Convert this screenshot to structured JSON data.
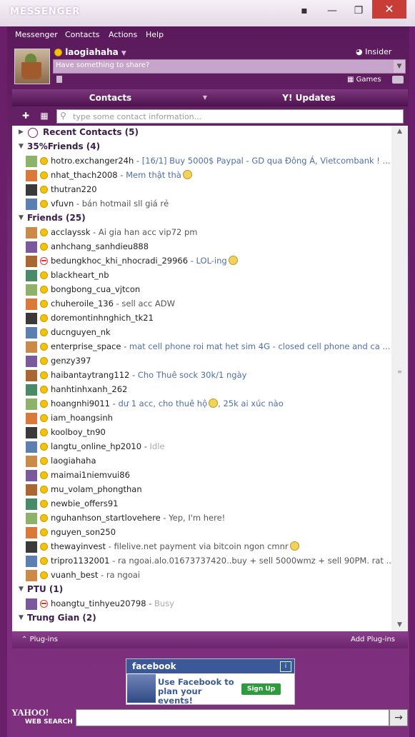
{
  "window": {
    "title": "MESSENGER",
    "min_label": "—",
    "max_label": "❐",
    "close_label": "✕"
  },
  "menu": {
    "items": [
      "Messenger",
      "Contacts",
      "Actions",
      "Help"
    ]
  },
  "profile": {
    "username": "laogiahaha",
    "insider_label": "Insider",
    "share_placeholder": "Have something to share?",
    "games_label": "Games"
  },
  "tabs": {
    "contacts": "Contacts",
    "updates": "Y! Updates"
  },
  "search": {
    "placeholder": "type some contact information..."
  },
  "contacts": {
    "recent": {
      "label": "Recent Contacts (5)"
    },
    "groups": [
      {
        "label": "35%Friends (4)",
        "rows": [
          {
            "name": "hotro.exchanger24h",
            "msg": "[16/1] Buy 5000$ Paypal - GD qua Đông Á, Vietcombank ! ...",
            "status": "available",
            "style": "blue"
          },
          {
            "name": "nhat_thach2008",
            "msg": "Mem thật thà",
            "status": "available",
            "style": "blue",
            "emoji": true
          },
          {
            "name": "thutran220",
            "msg": "",
            "status": "available"
          },
          {
            "name": "vfuvn",
            "msg": "bán hotmail sll giá rẻ",
            "status": "available",
            "style": "gray"
          }
        ]
      },
      {
        "label": "Friends (25)",
        "rows": [
          {
            "name": "acclayssk",
            "msg": "Ai gia han acc vip72 pm",
            "status": "available",
            "style": "gray"
          },
          {
            "name": "anhchang_sanhdieu888",
            "msg": "",
            "status": "available"
          },
          {
            "name": "bedungkhoc_khi_nhocradi_29966",
            "msg": "LOL-ing",
            "status": "busy",
            "style": "blue",
            "emoji": true
          },
          {
            "name": "blackheart_nb",
            "msg": "",
            "status": "available"
          },
          {
            "name": "bongbong_cua_vjtcon",
            "msg": "",
            "status": "available"
          },
          {
            "name": "chuheroile_136",
            "msg": "sell acc ADW",
            "status": "available",
            "style": "gray"
          },
          {
            "name": "doremontinhnghich_tk21",
            "msg": "",
            "status": "available"
          },
          {
            "name": "ducnguyen_nk",
            "msg": "",
            "status": "available"
          },
          {
            "name": "enterprise_space",
            "msg": "mat cell phone roi mat het sim 4G - closed cell phone and ca ...",
            "status": "available",
            "style": "blue"
          },
          {
            "name": "genzy397",
            "msg": "",
            "status": "available"
          },
          {
            "name": "haibantaytrang112",
            "msg": "Cho Thuê sock 30k/1 ngày",
            "status": "available",
            "style": "blue"
          },
          {
            "name": "hanhtinhxanh_262",
            "msg": "",
            "status": "available"
          },
          {
            "name": "hoangnhi9011",
            "msg": "dư 1 acc, cho thuê hộ",
            "msg2": ", 25k ai xúc nào",
            "status": "available",
            "style": "blue",
            "emoji": true
          },
          {
            "name": "iam_hoangsinh",
            "msg": "",
            "status": "available"
          },
          {
            "name": "koolboy_tn90",
            "msg": "",
            "status": "available"
          },
          {
            "name": "langtu_online_hp2010",
            "msg": "Idle",
            "status": "idle",
            "style": "idle"
          },
          {
            "name": "laogiahaha",
            "msg": "",
            "status": "available"
          },
          {
            "name": "maimai1niemvui86",
            "msg": "",
            "status": "available"
          },
          {
            "name": "mu_volam_phongthan",
            "msg": "",
            "status": "available"
          },
          {
            "name": "newbie_offers91",
            "msg": "",
            "status": "available"
          },
          {
            "name": "nguhanhson_startlovehere",
            "msg": "Yep, I'm here!",
            "status": "available",
            "style": "gray"
          },
          {
            "name": "nguyen_son250",
            "msg": "",
            "status": "available"
          },
          {
            "name": "thewayinvest",
            "msg": "filelive.net  payment via bitcoin ngon cmnr",
            "status": "available",
            "style": "gray",
            "emoji": true
          },
          {
            "name": "tripro1132001",
            "msg": "ra ngoai.alo.01673737420..buy + sell 5000wmz + sell 90PM. rat ...",
            "status": "idle",
            "style": "gray"
          },
          {
            "name": "vuanh_best",
            "msg": "ra ngoai",
            "status": "available",
            "style": "gray"
          }
        ]
      },
      {
        "label": "PTU (1)",
        "rows": [
          {
            "name": "hoangtu_tinhyeu20798",
            "msg": "Busy",
            "status": "busy",
            "style": "idle"
          }
        ]
      },
      {
        "label": "Trung Gian (2)",
        "rows": []
      }
    ],
    "sep": " - "
  },
  "footer": {
    "plugins": "Plug-ins",
    "add_plugins": "Add Plug-ins"
  },
  "ad": {
    "brand": "facebook",
    "info": "i",
    "text": "Use Facebook to plan your events!",
    "button": "Sign Up"
  },
  "websearch": {
    "logo": "YAHOO!",
    "label": "WEB SEARCH",
    "go": "→"
  },
  "colors": {
    "frame": "#6b1f6b",
    "status_text": "#4f6fa8",
    "available": "#f4c20d",
    "busy": "#dd3333"
  },
  "icons": [
    "search-icon",
    "add-contact-icon",
    "grid-icon",
    "clock-icon",
    "mail-icon",
    "games-icon"
  ]
}
